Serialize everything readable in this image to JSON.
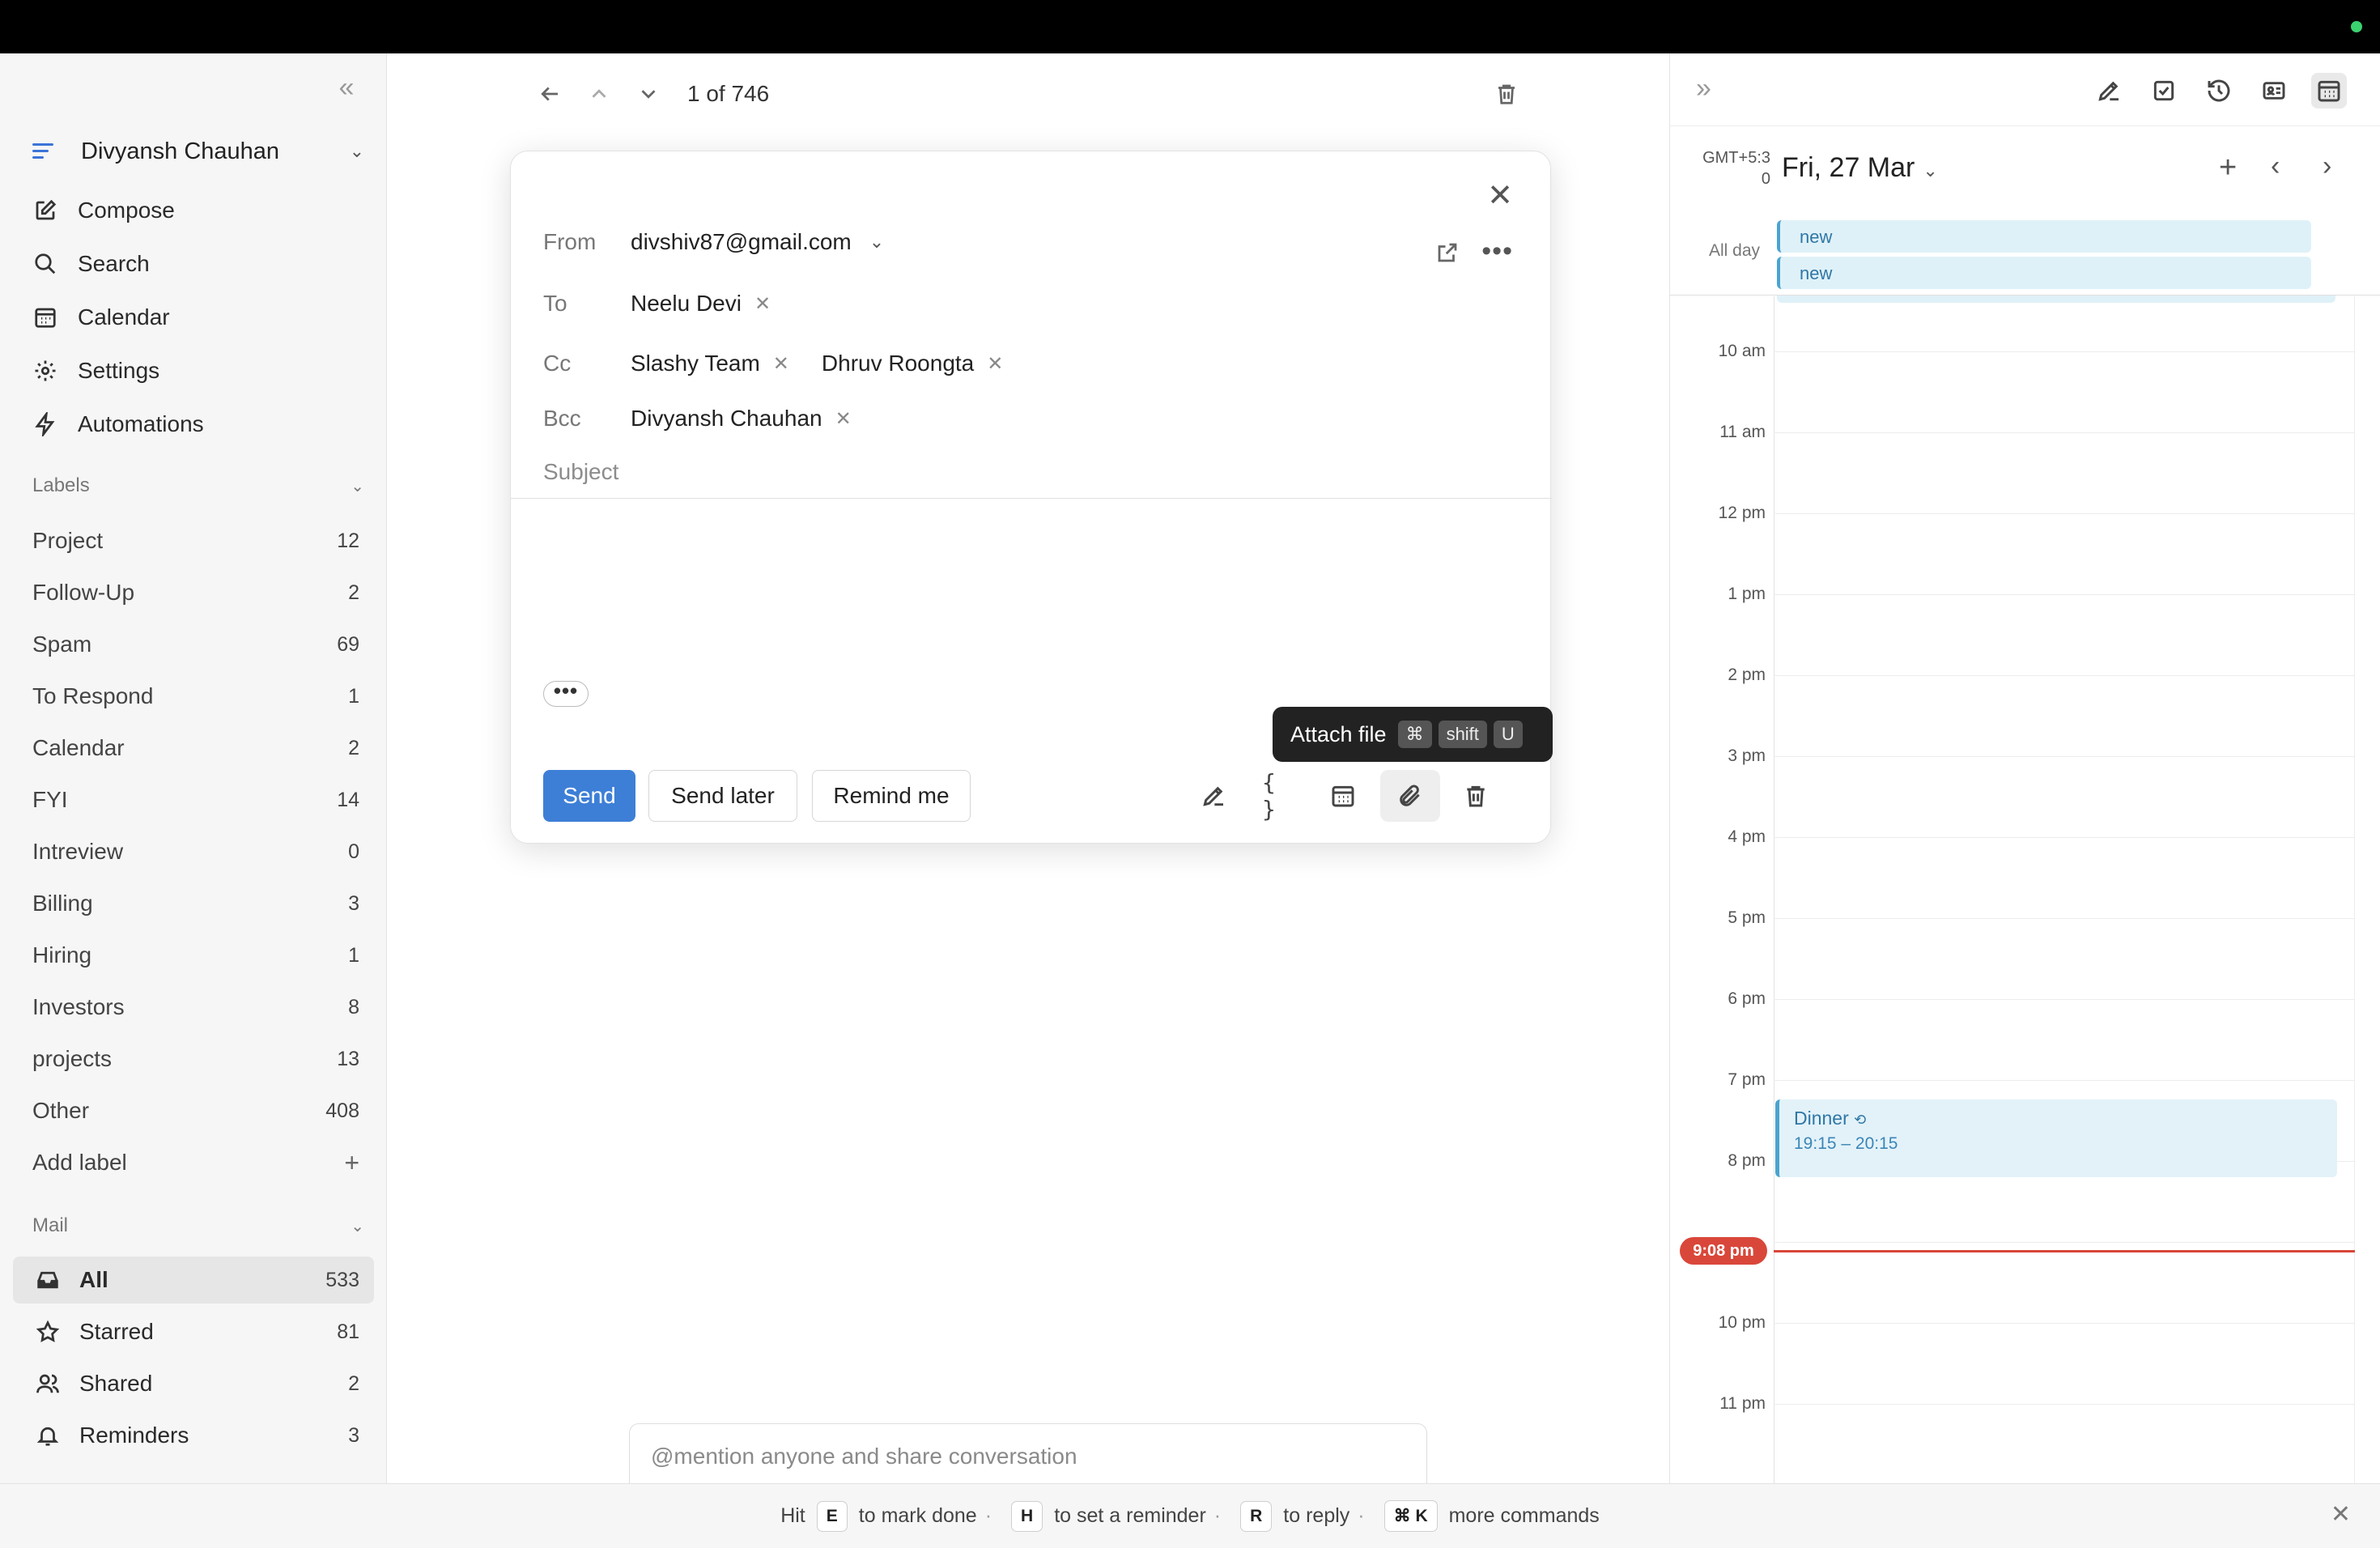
{
  "sidebar": {
    "account_name": "Divyansh Chauhan",
    "nav": [
      {
        "label": "Compose",
        "icon": "compose-icon"
      },
      {
        "label": "Search",
        "icon": "search-icon"
      },
      {
        "label": "Calendar",
        "icon": "calendar-icon"
      },
      {
        "label": "Settings",
        "icon": "gear-icon"
      },
      {
        "label": "Automations",
        "icon": "bolt-icon"
      }
    ],
    "labels_title": "Labels",
    "labels": [
      {
        "label": "Project",
        "count": "12"
      },
      {
        "label": "Follow-Up",
        "count": "2"
      },
      {
        "label": "Spam",
        "count": "69"
      },
      {
        "label": "To Respond",
        "count": "1"
      },
      {
        "label": "Calendar",
        "count": "2"
      },
      {
        "label": "FYI",
        "count": "14"
      },
      {
        "label": "Intreview",
        "count": "0"
      },
      {
        "label": "Billing",
        "count": "3"
      },
      {
        "label": "Hiring",
        "count": "1"
      },
      {
        "label": "Investors",
        "count": "8"
      },
      {
        "label": "projects",
        "count": "13"
      },
      {
        "label": "Other",
        "count": "408"
      }
    ],
    "add_label": "Add label",
    "mail_title": "Mail",
    "mail": [
      {
        "label": "All",
        "count": "533",
        "icon": "inbox-icon"
      },
      {
        "label": "Starred",
        "count": "81",
        "icon": "star-icon"
      },
      {
        "label": "Shared",
        "count": "2",
        "icon": "people-icon"
      },
      {
        "label": "Reminders",
        "count": "3",
        "icon": "bell-icon"
      }
    ]
  },
  "toolbar": {
    "pager": "1 of 746"
  },
  "compose": {
    "from_label": "From",
    "from_value": "divshiv87@gmail.com",
    "to_label": "To",
    "to": [
      "Neelu Devi"
    ],
    "cc_label": "Cc",
    "cc": [
      "Slashy Team",
      "Dhruv Roongta"
    ],
    "bcc_label": "Bcc",
    "bcc": [
      "Divyansh Chauhan"
    ],
    "subject_placeholder": "Subject",
    "send": "Send",
    "send_later": "Send later",
    "remind_me": "Remind me",
    "tooltip": {
      "text": "Attach file",
      "keys": [
        "⌘",
        "shift",
        "U"
      ]
    }
  },
  "mention_placeholder": "@mention anyone and share conversation",
  "calendar": {
    "timezone_line1": "GMT+5:3",
    "timezone_line2": "0",
    "date": "Fri, 27 Mar",
    "allday_label": "All day",
    "allday_events": [
      "new",
      "new"
    ],
    "hours": [
      "10 am",
      "11 am",
      "12 pm",
      "1 pm",
      "2 pm",
      "3 pm",
      "4 pm",
      "5 pm",
      "6 pm",
      "7 pm",
      "8 pm",
      "10 pm",
      "11 pm"
    ],
    "event": {
      "title": "Dinner",
      "time": "19:15 – 20:15"
    },
    "now": "9:08 pm"
  },
  "footer": {
    "hit": "Hit",
    "k1": "E",
    "t1": "to mark done",
    "k2": "H",
    "t2": "to set a reminder",
    "k3": "R",
    "t3": "to reply",
    "k4": "⌘ K",
    "t4": "more commands"
  },
  "colors": {
    "accent": "#3d7fd6",
    "now": "#d9473a",
    "event": "#4aa4d0"
  }
}
